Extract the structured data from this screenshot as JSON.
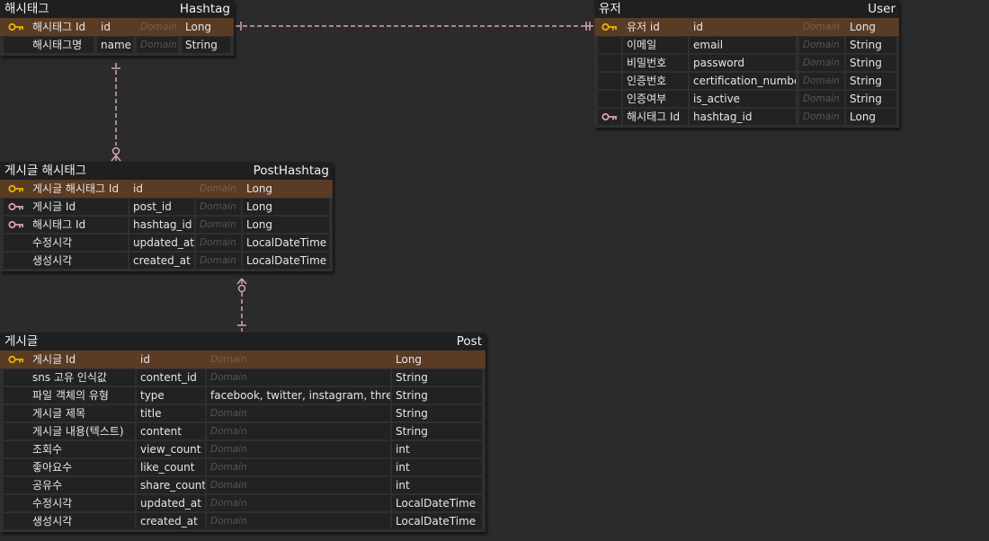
{
  "colors": {
    "background": "#2b2b2b",
    "header": "#1f1f1f",
    "pk_row": "#5a3b24",
    "pk_key": "#e5b400",
    "fk_key": "#d9a0ac",
    "relationship_line": "#d6a6b0"
  },
  "entities": [
    {
      "id": "hashtag",
      "logical_name": "해시태그",
      "physical_name": "Hashtag",
      "columns": [
        {
          "logical": "해시태그 Id",
          "physical": "id",
          "domain": "Domain",
          "type": "Long",
          "key": "pk"
        },
        {
          "logical": "해시태그명",
          "physical": "name",
          "domain": "Domain",
          "type": "String",
          "key": ""
        }
      ]
    },
    {
      "id": "user",
      "logical_name": "유저",
      "physical_name": "User",
      "columns": [
        {
          "logical": "유저 id",
          "physical": "id",
          "domain": "Domain",
          "type": "Long",
          "key": "pk"
        },
        {
          "logical": "이메일",
          "physical": "email",
          "domain": "Domain",
          "type": "String",
          "key": ""
        },
        {
          "logical": "비밀번호",
          "physical": "password",
          "domain": "Domain",
          "type": "String",
          "key": ""
        },
        {
          "logical": "인증번호",
          "physical": "certification_number",
          "domain": "Domain",
          "type": "String",
          "key": ""
        },
        {
          "logical": "인증여부",
          "physical": "is_active",
          "domain": "Domain",
          "type": "String",
          "key": ""
        },
        {
          "logical": "해시태그 Id",
          "physical": "hashtag_id",
          "domain": "Domain",
          "type": "Long",
          "key": "fk"
        }
      ]
    },
    {
      "id": "post_hashtag",
      "logical_name": "게시글 해시태그",
      "physical_name": "PostHashtag",
      "columns": [
        {
          "logical": "게시글 해시태그 Id",
          "physical": "id",
          "domain": "Domain",
          "type": "Long",
          "key": "pk"
        },
        {
          "logical": "게시글 Id",
          "physical": "post_id",
          "domain": "Domain",
          "type": "Long",
          "key": "fk"
        },
        {
          "logical": "해시태그 Id",
          "physical": "hashtag_id",
          "domain": "Domain",
          "type": "Long",
          "key": "fk"
        },
        {
          "logical": "수정시각",
          "physical": "updated_at",
          "domain": "Domain",
          "type": "LocalDateTime",
          "key": ""
        },
        {
          "logical": "생성시각",
          "physical": "created_at",
          "domain": "Domain",
          "type": "LocalDateTime",
          "key": ""
        }
      ]
    },
    {
      "id": "post",
      "logical_name": "게시글",
      "physical_name": "Post",
      "columns": [
        {
          "logical": "게시글 Id",
          "physical": "id",
          "domain": "Domain",
          "type": "Long",
          "key": "pk"
        },
        {
          "logical": "sns 고유 인식값",
          "physical": "content_id",
          "domain": "Domain",
          "type": "String",
          "key": ""
        },
        {
          "logical": "파일 객체의 유형",
          "physical": "type",
          "domain": "facebook, twitter, instagram, threads",
          "type": "String",
          "key": "",
          "domain_is_value": true
        },
        {
          "logical": "게시글 제목",
          "physical": "title",
          "domain": "Domain",
          "type": "String",
          "key": ""
        },
        {
          "logical": "게시글 내용(텍스트)",
          "physical": "content",
          "domain": "Domain",
          "type": "String",
          "key": ""
        },
        {
          "logical": "조회수",
          "physical": "view_count",
          "domain": "Domain",
          "type": "int",
          "key": ""
        },
        {
          "logical": "좋아요수",
          "physical": "like_count",
          "domain": "Domain",
          "type": "int",
          "key": ""
        },
        {
          "logical": "공유수",
          "physical": "share_count",
          "domain": "Domain",
          "type": "int",
          "key": ""
        },
        {
          "logical": "수정시각",
          "physical": "updated_at",
          "domain": "Domain",
          "type": "LocalDateTime",
          "key": ""
        },
        {
          "logical": "생성시각",
          "physical": "created_at",
          "domain": "Domain",
          "type": "LocalDateTime",
          "key": ""
        }
      ]
    }
  ]
}
